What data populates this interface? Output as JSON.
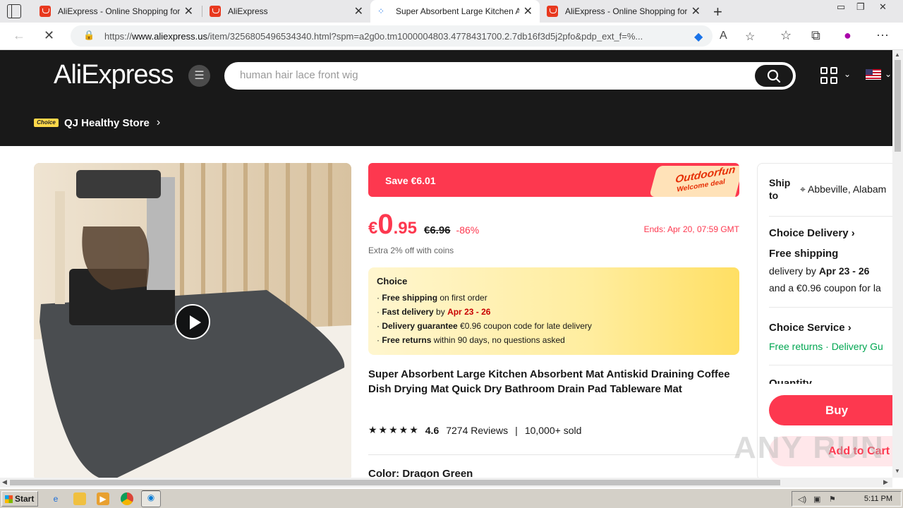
{
  "browser": {
    "tabs": [
      {
        "title": "AliExpress - Online Shopping for",
        "active": false
      },
      {
        "title": "AliExpress",
        "active": false
      },
      {
        "title": "Super Absorbent Large Kitchen A",
        "active": true
      },
      {
        "title": "AliExpress - Online Shopping for",
        "active": false
      }
    ],
    "url_prefix": "https://",
    "url_domain": "www.aliexpress.us",
    "url_rest": "/item/3256805496534340.html?spm=a2g0o.tm1000004803.4778431700.2.7db16f3d5j2pfo&pdp_ext_f=%..."
  },
  "header": {
    "logo": "AliExpress",
    "search_placeholder": "human hair lace front wig",
    "choice_badge": "Choice",
    "store_name": "QJ Healthy Store"
  },
  "product": {
    "save_text": "Save €6.01",
    "promo_tag_line1": "Outdoorfun",
    "promo_tag_line2": "Welcome deal",
    "price_currency": "€",
    "price_int": "0",
    "price_dec": ".95",
    "original_price": "€6.96",
    "discount": "-86%",
    "ends": "Ends: Apr 20, 07:59 GMT",
    "coins_note": "Extra 2% off with coins",
    "choice_box": {
      "header": "Choice",
      "items": [
        {
          "bold": "Free shipping",
          "text": " on first order",
          "red": ""
        },
        {
          "bold": "Fast delivery",
          "text": " by ",
          "red": "Apr 23 - 26"
        },
        {
          "bold": "Delivery guarantee",
          "text": "  €0.96 coupon code for late delivery",
          "red": ""
        },
        {
          "bold": "Free returns",
          "text": "  within 90 days, no questions asked",
          "red": ""
        }
      ]
    },
    "title": "Super Absorbent Large Kitchen Absorbent Mat Antiskid Draining Coffee Dish Drying Mat Quick Dry Bathroom Drain Pad Tableware Mat",
    "stars": "★★★★★",
    "rating": "4.6",
    "reviews": "7274 Reviews",
    "sold": "10,000+ sold",
    "color_label": "Color: Dragon Green"
  },
  "shipping": {
    "ship_to": "Ship to",
    "location": "Abbeville, Alabam",
    "choice_delivery": "Choice Delivery",
    "free_shipping": "Free shipping",
    "delivery_prefix": "delivery by ",
    "delivery_dates": "Apr 23 - 26",
    "coupon": "and a €0.96 coupon for la",
    "choice_service": "Choice Service",
    "service_items": "Free returns · Delivery Gu",
    "quantity": "Quantity",
    "buy_now": "Buy now",
    "add_to_cart": "Add to Cart"
  },
  "taskbar": {
    "start": "Start",
    "time": "5:11 PM"
  },
  "watermark": "ANY RUN"
}
